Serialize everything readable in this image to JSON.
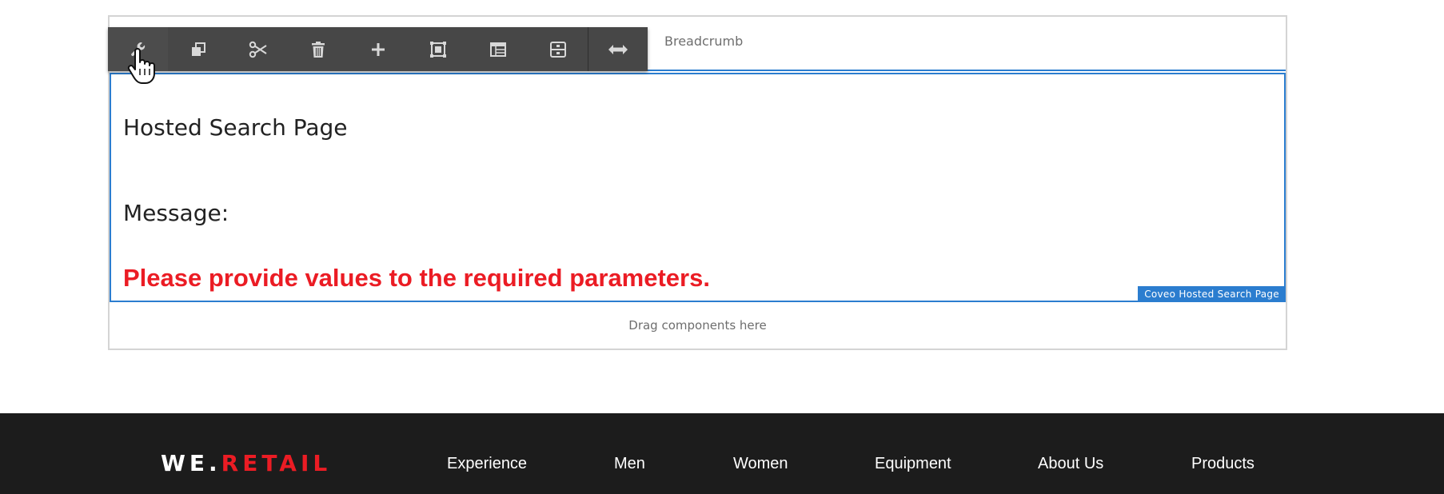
{
  "toolbar": {
    "tools": [
      {
        "name": "configure",
        "icon": "wrench-icon"
      },
      {
        "name": "copy",
        "icon": "copy-icon"
      },
      {
        "name": "cut",
        "icon": "scissors-icon"
      },
      {
        "name": "delete",
        "icon": "trash-icon"
      },
      {
        "name": "insert",
        "icon": "plus-icon"
      },
      {
        "name": "group",
        "icon": "group-frame-icon"
      },
      {
        "name": "layout",
        "icon": "layout-icon"
      },
      {
        "name": "parent",
        "icon": "parent-icon"
      },
      {
        "name": "resize",
        "icon": "resize-arrows-icon"
      }
    ]
  },
  "editor": {
    "breadcrumb_label": "Breadcrumb",
    "component": {
      "title": "Hosted Search Page",
      "message_label": "Message:",
      "error_text": "Please provide values to the required parameters.",
      "tag": "Coveo Hosted Search Page"
    },
    "drop_zone_label": "Drag components here"
  },
  "footer": {
    "logo": {
      "we": "WE",
      "dot": ".",
      "retail": "RETAIL"
    },
    "nav": [
      "Experience",
      "Men",
      "Women",
      "Equipment",
      "About Us",
      "Products"
    ]
  },
  "colors": {
    "accent_blue": "#2b7dcf",
    "error_red": "#eb1c24",
    "toolbar_bg": "#474747",
    "footer_bg": "#1c1c1c"
  }
}
